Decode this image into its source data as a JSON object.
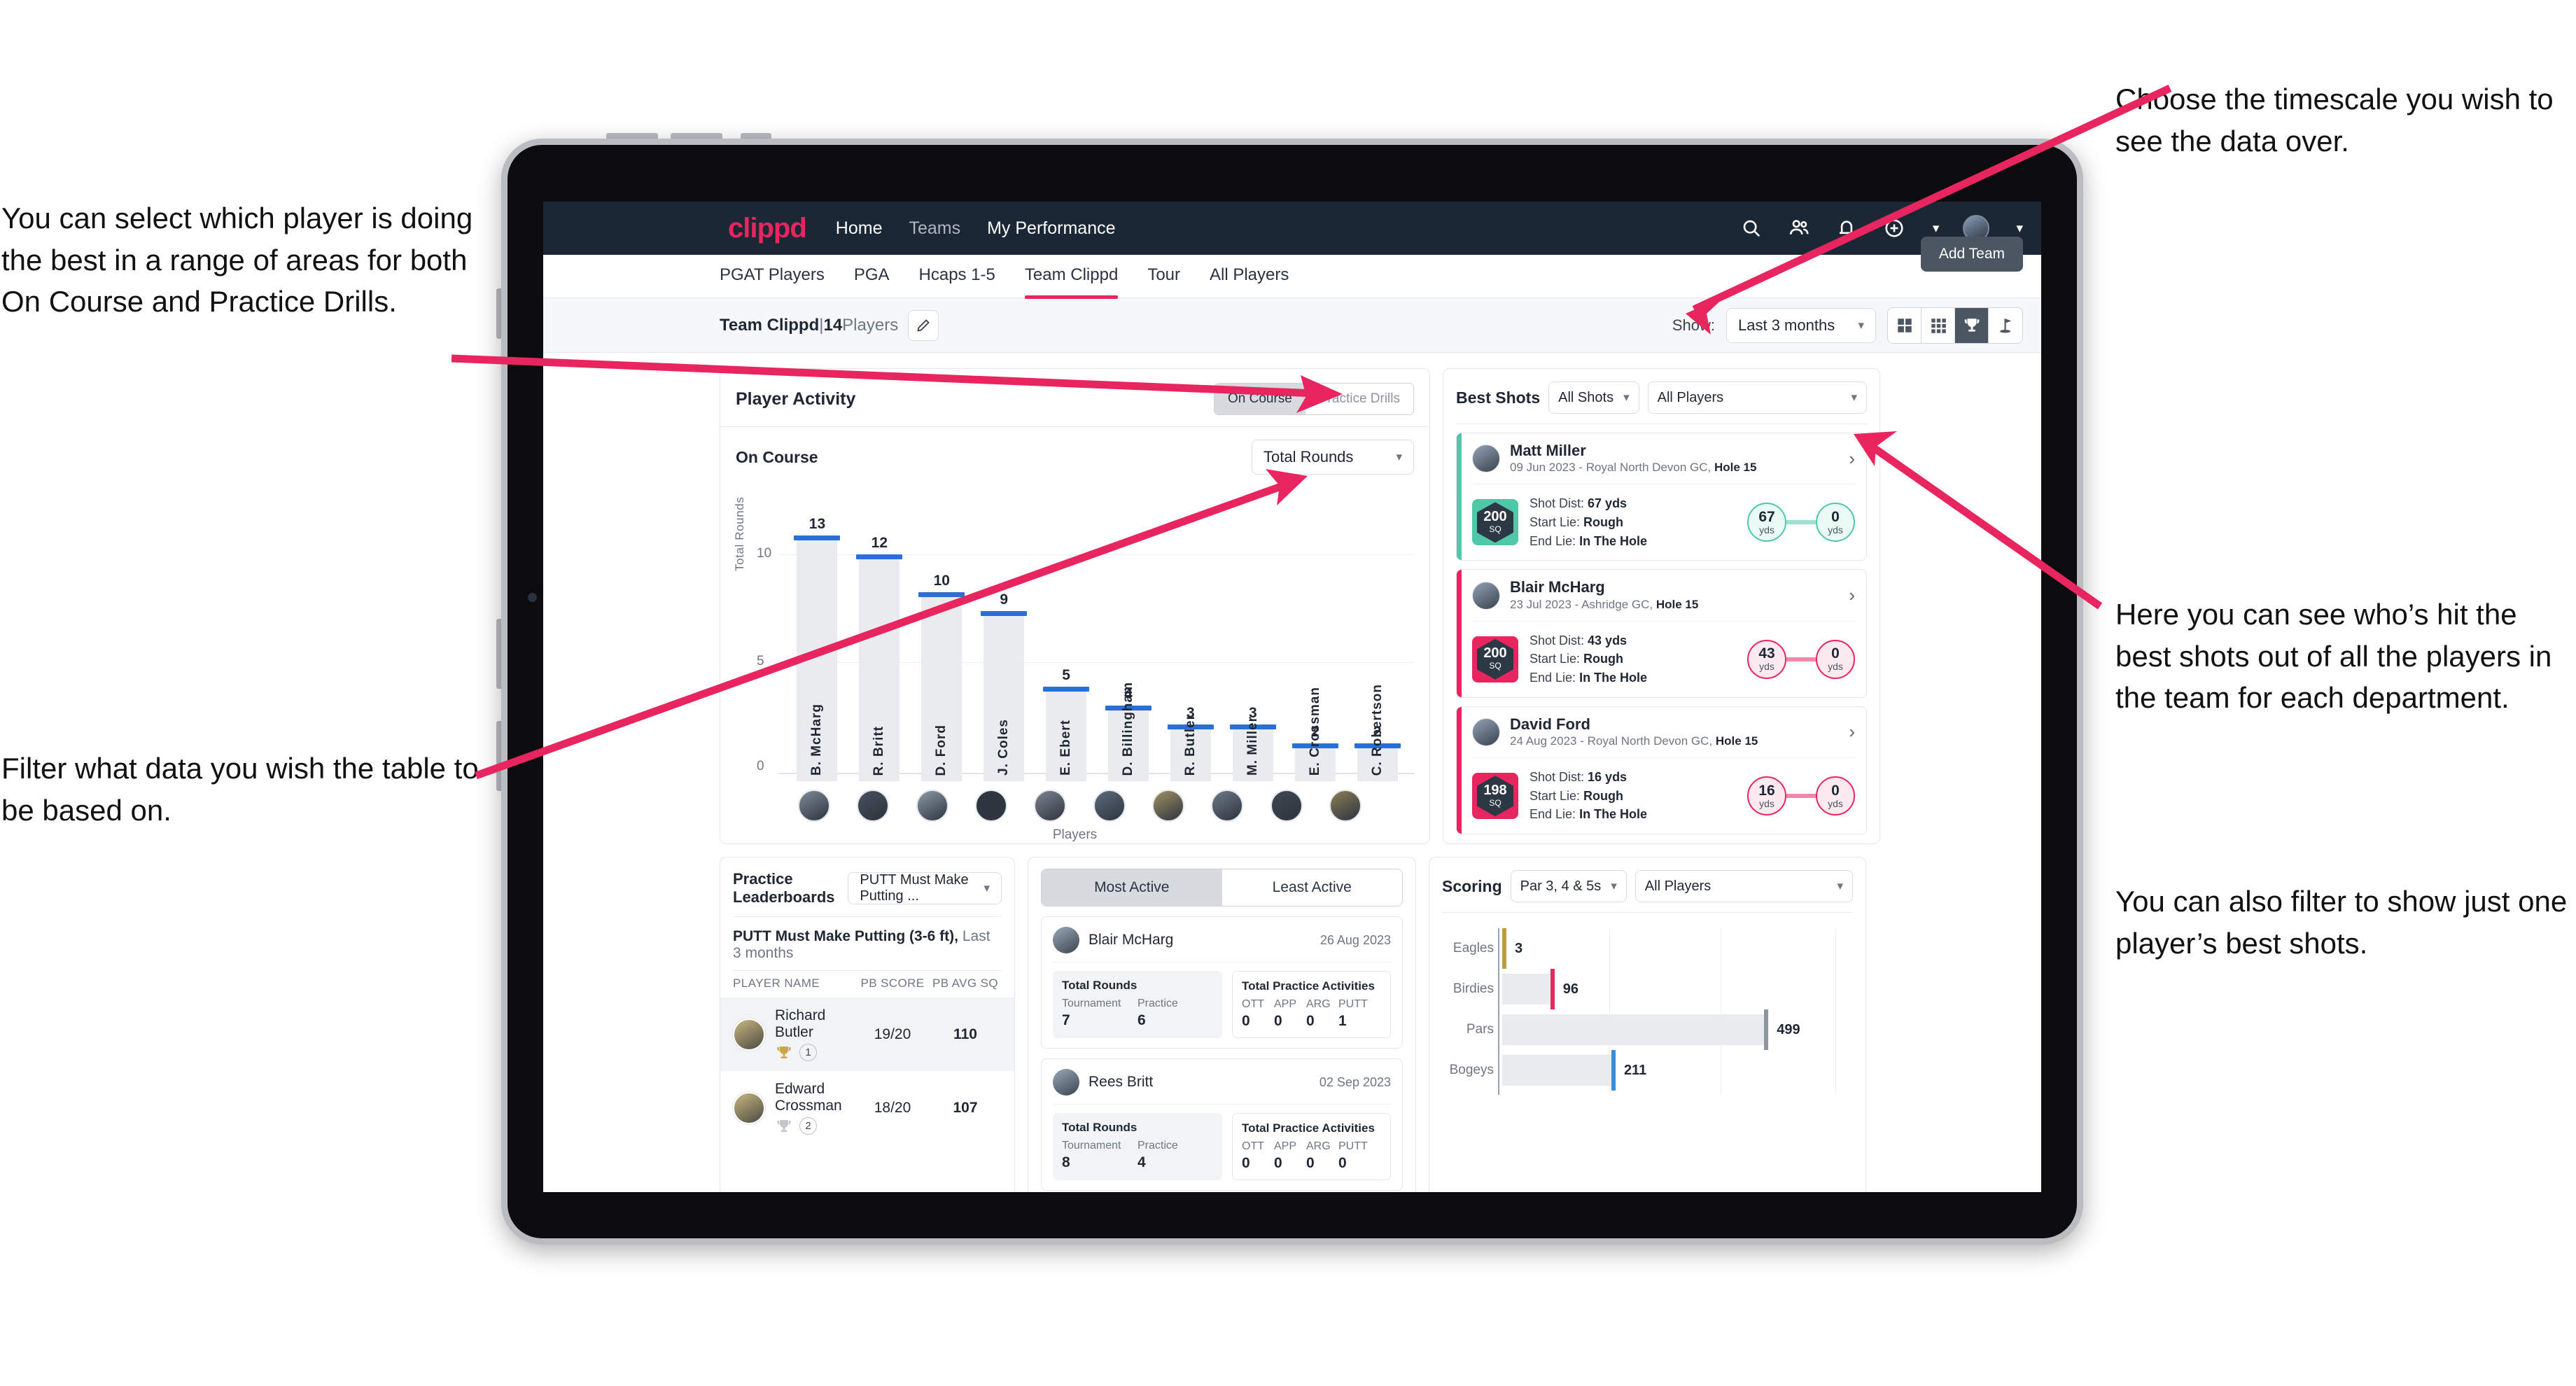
{
  "annotations": {
    "left_top": "You can select which player is doing the best in a range of areas for both On Course and Practice Drills.",
    "left_bottom": "Filter what data you wish the table to be based on.",
    "right_top": "Choose the timescale you wish to see the data over.",
    "right_mid": "Here you can see who’s hit the best shots out of all the players in the team for each department.",
    "right_bottom": "You can also filter to show just one player’s best shots."
  },
  "app": {
    "logo": "clippd",
    "nav": [
      {
        "label": "Home",
        "active": true
      },
      {
        "label": "Teams",
        "active": false
      },
      {
        "label": "My Performance",
        "active": false
      }
    ],
    "nav_icons": [
      "search-icon",
      "people-icon",
      "bell-icon",
      "plus-circle-icon",
      "avatar"
    ],
    "tabs": [
      {
        "label": "PGAT Players",
        "active": false
      },
      {
        "label": "PGA",
        "active": false
      },
      {
        "label": "Hcaps 1-5",
        "active": false
      },
      {
        "label": "Team Clippd",
        "active": true
      },
      {
        "label": "Tour",
        "active": false
      },
      {
        "label": "All Players",
        "active": false
      }
    ],
    "add_team_button": "Add Team"
  },
  "toolbar": {
    "team_name": "Team Clippd",
    "separator": "|",
    "player_count": "14",
    "players_word": "Players",
    "edit_icon": "pencil-icon",
    "show_label": "Show:",
    "timescale_value": "Last 3 months",
    "view_toggles": [
      {
        "icon": "grid-2x2-icon",
        "active": false
      },
      {
        "icon": "grid-3x3-icon",
        "active": false
      },
      {
        "icon": "trophy-icon",
        "active": true
      },
      {
        "icon": "flag-pin-icon",
        "active": false
      }
    ]
  },
  "player_activity": {
    "title": "Player Activity",
    "segments": [
      {
        "label": "On Course",
        "active": true
      },
      {
        "label": "Practice Drills",
        "active": false
      }
    ],
    "subtitle": "On Course",
    "metric_select": "Total Rounds"
  },
  "chart_data": [
    {
      "type": "bar",
      "title": "Player Activity",
      "xlabel": "Players",
      "ylabel": "Total Rounds",
      "ylim": [
        0,
        14
      ],
      "yticks": [
        0,
        5,
        10
      ],
      "grid": true,
      "categories": [
        "B. McHarg",
        "R. Britt",
        "D. Ford",
        "J. Coles",
        "E. Ebert",
        "D. Billingham",
        "R. Butler",
        "M. Miller",
        "E. Crossman",
        "C. Robertson"
      ],
      "values": [
        13,
        12,
        10,
        9,
        5,
        4,
        3,
        3,
        2,
        2
      ]
    },
    {
      "type": "bar",
      "title": "Scoring",
      "orientation": "horizontal",
      "categories": [
        "Eagles",
        "Birdies",
        "Pars",
        "Bogeys"
      ],
      "values": [
        3,
        96,
        499,
        211
      ],
      "colors": [
        "#bf9b46",
        "#e8255f",
        "#8d959e",
        "#3a8fd8"
      ],
      "xlim": [
        0,
        620
      ],
      "grid": true
    }
  ],
  "best_shots": {
    "title": "Best Shots",
    "shot_filter": "All Shots",
    "player_filter": "All Players",
    "cards": [
      {
        "name": "Matt Miller",
        "meta_date": "09 Jun 2023",
        "meta_course": "Royal North Devon GC,",
        "meta_hole": "Hole 15",
        "badge_value": "200",
        "badge_unit": "SQ",
        "accent": "#4fc8a8",
        "shot_dist_label": "Shot Dist:",
        "shot_dist": "67 yds",
        "start_lie_label": "Start Lie:",
        "start_lie": "Rough",
        "end_lie_label": "End Lie:",
        "end_lie": "In The Hole",
        "from_value": "67",
        "from_unit": "yds",
        "to_value": "0",
        "to_unit": "yds"
      },
      {
        "name": "Blair McHarg",
        "meta_date": "23 Jul 2023",
        "meta_course": "Ashridge GC,",
        "meta_hole": "Hole 15",
        "badge_value": "200",
        "badge_unit": "SQ",
        "accent": "#e8255f",
        "shot_dist_label": "Shot Dist:",
        "shot_dist": "43 yds",
        "start_lie_label": "Start Lie:",
        "start_lie": "Rough",
        "end_lie_label": "End Lie:",
        "end_lie": "In The Hole",
        "from_value": "43",
        "from_unit": "yds",
        "to_value": "0",
        "to_unit": "yds"
      },
      {
        "name": "David Ford",
        "meta_date": "24 Aug 2023",
        "meta_course": "Royal North Devon GC,",
        "meta_hole": "Hole 15",
        "badge_value": "198",
        "badge_unit": "SQ",
        "accent": "#e8255f",
        "shot_dist_label": "Shot Dist:",
        "shot_dist": "16 yds",
        "start_lie_label": "Start Lie:",
        "start_lie": "Rough",
        "end_lie_label": "End Lie:",
        "end_lie": "In The Hole",
        "from_value": "16",
        "from_unit": "yds",
        "to_value": "0",
        "to_unit": "yds"
      }
    ]
  },
  "practice_leaderboards": {
    "title": "Practice Leaderboards",
    "drill_select": "PUTT Must Make Putting ...",
    "subtitle_bold": "PUTT Must Make Putting (3-6 ft),",
    "subtitle_light": "Last 3 months",
    "columns": [
      "PLAYER NAME",
      "PB SCORE",
      "PB AVG SQ"
    ],
    "rows": [
      {
        "name": "Richard Butler",
        "rank": "1",
        "pb_score": "19/20",
        "pb_avg_sq": "110"
      },
      {
        "name": "Edward Crossman",
        "rank": "2",
        "pb_score": "18/20",
        "pb_avg_sq": "107"
      }
    ]
  },
  "activity": {
    "tabs": [
      {
        "label": "Most Active",
        "active": true
      },
      {
        "label": "Least Active",
        "active": false
      }
    ],
    "cards": [
      {
        "name": "Blair McHarg",
        "date": "26 Aug 2023",
        "rounds_title": "Total Rounds",
        "rounds_labels": [
          "Tournament",
          "Practice"
        ],
        "rounds_values": [
          "7",
          "6"
        ],
        "practice_title": "Total Practice Activities",
        "practice_labels": [
          "OTT",
          "APP",
          "ARG",
          "PUTT"
        ],
        "practice_values": [
          "0",
          "0",
          "0",
          "1"
        ]
      },
      {
        "name": "Rees Britt",
        "date": "02 Sep 2023",
        "rounds_title": "Total Rounds",
        "rounds_labels": [
          "Tournament",
          "Practice"
        ],
        "rounds_values": [
          "8",
          "4"
        ],
        "practice_title": "Total Practice Activities",
        "practice_labels": [
          "OTT",
          "APP",
          "ARG",
          "PUTT"
        ],
        "practice_values": [
          "0",
          "0",
          "0",
          "0"
        ]
      }
    ]
  },
  "scoring": {
    "title": "Scoring",
    "par_filter": "Par 3, 4 & 5s",
    "player_filter": "All Players"
  }
}
